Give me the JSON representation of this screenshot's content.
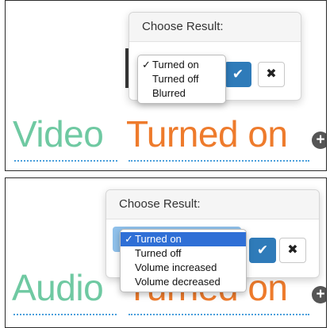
{
  "video": {
    "popover_title": "Choose Result:",
    "options": [
      "Turned on",
      "Turned off",
      "Blurred"
    ],
    "selected_option": "Turned on",
    "check_mark": "✓",
    "field_label": "Video",
    "field_value": "Turned on",
    "ok_icon": "checkmark-icon",
    "cancel_icon": "close-icon"
  },
  "audio": {
    "popover_title": "Choose Result:",
    "options": [
      "Turned on",
      "Turned off",
      "Volume increased",
      "Volume decreased"
    ],
    "selected_option": "Turned on",
    "check_mark": "✓",
    "field_label": "Audio",
    "field_value": "Turned on",
    "ok_icon": "checkmark-icon",
    "cancel_icon": "close-icon"
  },
  "colors": {
    "label": "#6fc9a2",
    "value": "#ee7b2c",
    "primary_button": "#2f7bb9",
    "highlight": "#2f6fd6",
    "dotted_underline": "#4a9fdc"
  }
}
